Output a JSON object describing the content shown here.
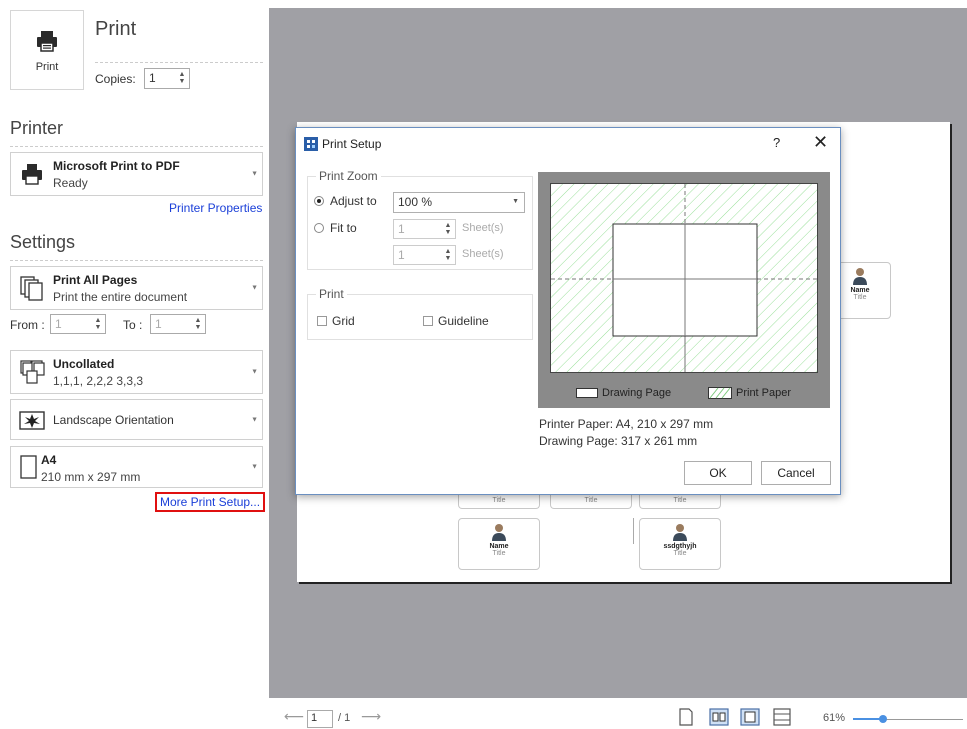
{
  "print_section": {
    "button_label": "Print",
    "heading": "Print",
    "copies_label": "Copies:",
    "copies_value": "1"
  },
  "printer": {
    "heading": "Printer",
    "name": "Microsoft Print to PDF",
    "status": "Ready",
    "properties_link": "Printer Properties"
  },
  "settings": {
    "heading": "Settings",
    "pages": {
      "title": "Print All Pages",
      "subtitle": "Print the entire document"
    },
    "range": {
      "from_label": "From :",
      "from_value": "1",
      "to_label": "To :",
      "to_value": "1"
    },
    "collate": {
      "title": "Uncollated",
      "subtitle": "1,1,1, 2,2,2 3,3,3"
    },
    "orientation": {
      "label": "Landscape Orientation"
    },
    "paper": {
      "title": "A4",
      "subtitle": "210 mm x 297 mm"
    },
    "more_link": "More Print Setup..."
  },
  "org_chart": {
    "cards": [
      {
        "name": "Name",
        "title": "Title"
      },
      {
        "name": "ssdgthyjh",
        "title": "Title"
      },
      {
        "name": "Name",
        "title": "Title"
      }
    ],
    "mini_titles": [
      "Title",
      "Title",
      "Title"
    ]
  },
  "bottom_bar": {
    "page_value": "1",
    "page_total": "/ 1",
    "zoom_label": "61%",
    "zoom_fraction": 0.27
  },
  "dialog": {
    "title": "Print Setup",
    "help": "?",
    "close": "✕",
    "zoom_group": {
      "legend": "Print Zoom",
      "adjust_label": "Adjust to",
      "adjust_value": "100 %",
      "fit_label": "Fit to",
      "fit_width_value": "1",
      "fit_height_value": "1",
      "sheets_label_1": "Sheet(s)",
      "sheets_label_2": "Sheet(s)"
    },
    "print_group": {
      "legend": "Print",
      "grid_label": "Grid",
      "guideline_label": "Guideline"
    },
    "preview_legend": {
      "drawing_page": "Drawing Page",
      "print_paper": "Print Paper"
    },
    "printer_paper_info": "Printer Paper: A4, 210 x 297 mm",
    "drawing_page_info": "Drawing Page: 317 x 261 mm",
    "ok_label": "OK",
    "cancel_label": "Cancel"
  },
  "colors": {
    "link_blue": "#1a3fd8",
    "highlight_red": "#e01010",
    "preview_gray": "#a0a0a5",
    "hatch_green": "#9be09b",
    "zoom_blue": "#4a90e2"
  }
}
